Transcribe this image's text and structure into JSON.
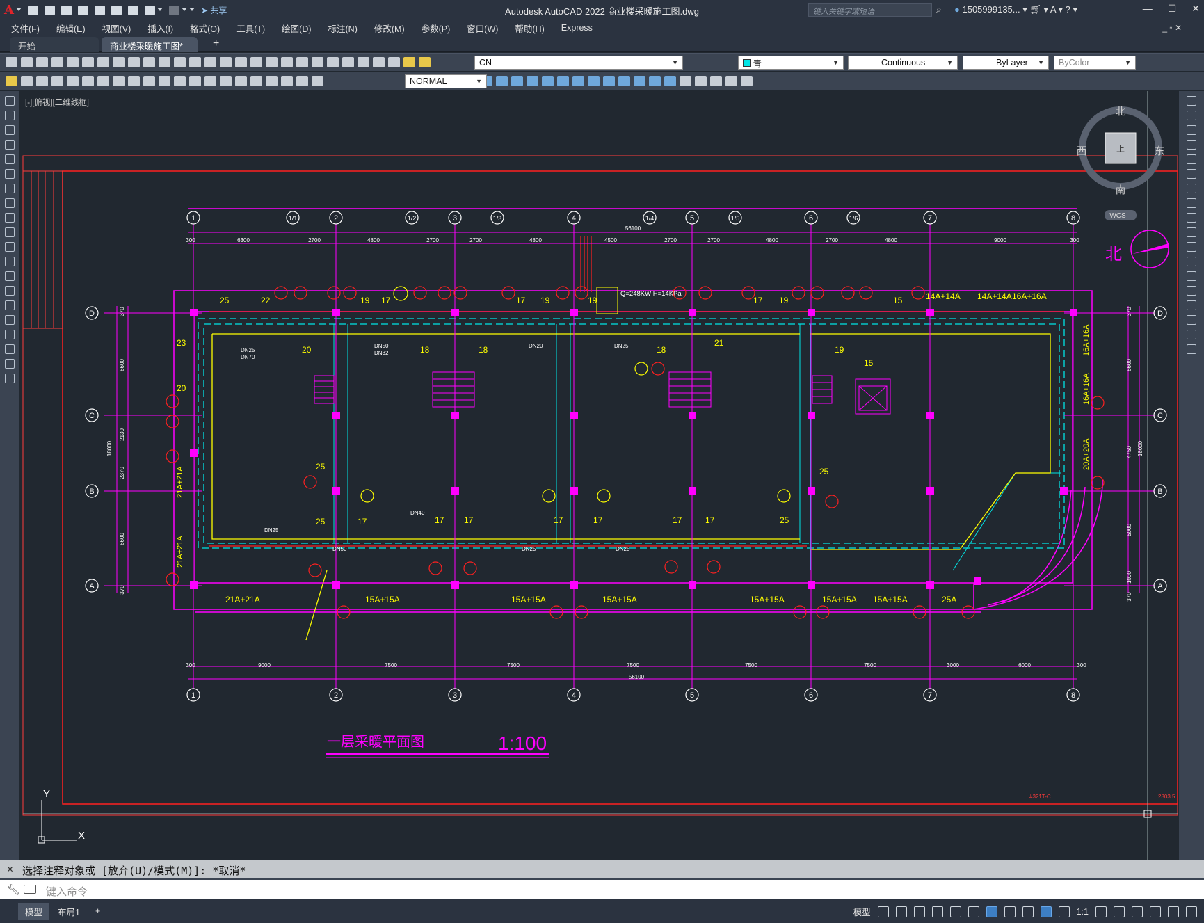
{
  "app": {
    "title": "Autodesk AutoCAD 2022    商业楼采暖施工图.dwg",
    "search_placeholder": "键入关键字或短语",
    "user": "1505999135...",
    "share": "共享"
  },
  "menu": [
    "文件(F)",
    "编辑(E)",
    "视图(V)",
    "插入(I)",
    "格式(O)",
    "工具(T)",
    "绘图(D)",
    "标注(N)",
    "修改(M)",
    "参数(P)",
    "窗口(W)",
    "帮助(H)",
    "Express"
  ],
  "file_tabs": {
    "start": "开始",
    "drawing": "商业楼采暖施工图*",
    "close": "×",
    "new": "+"
  },
  "properties": {
    "layer": "CN",
    "color": "青",
    "linetype": "Continuous",
    "lineweight": "ByLayer",
    "plotstyle": "ByColor",
    "dimstyle": "NORMAL",
    "accent_cyan": "#00e5e5",
    "magenta": "#ff00ff",
    "red": "#ff2020",
    "yellow": "#ffff00"
  },
  "viewport": {
    "label": "[-][俯视][二维线框]"
  },
  "viewcube": {
    "north": "北",
    "south": "南",
    "east": "东",
    "west": "西",
    "top_face": "上",
    "wcs": "WCS",
    "north_arrow": "北"
  },
  "drawing": {
    "title": "一层采暖平面图",
    "scale": "1:100",
    "top_axes": [
      "1",
      "1/1",
      "2",
      "1/2",
      "3",
      "1/3",
      "4",
      "1/4",
      "5",
      "1/5",
      "6",
      "1/6",
      "7",
      "8"
    ],
    "bottom_axes": [
      "1",
      "2",
      "3",
      "4",
      "5",
      "6",
      "7",
      "8"
    ],
    "side_axes": [
      "D",
      "C",
      "B",
      "A"
    ],
    "total_dim": "56100",
    "top_dims": [
      "300",
      "6300",
      "2700",
      "4800",
      "2700",
      "2700",
      "4800",
      "4500",
      "2700",
      "2700",
      "4800",
      "2700",
      "4800",
      "9000",
      "300"
    ],
    "bottom_dims": [
      "300",
      "9000",
      "7500",
      "7500",
      "7500",
      "7500",
      "7500",
      "3000",
      "6000",
      "300"
    ],
    "left_dims": [
      "370",
      "6600",
      "2130",
      "2370",
      "6600",
      "370"
    ],
    "left_total": "18000",
    "right_dims": [
      "370",
      "6600",
      "4750",
      "5000",
      "1000",
      "370"
    ],
    "right_total": "18000",
    "heat_load": "Q=248KW H=14KPa",
    "radiator_numbers": [
      "25",
      "22",
      "19",
      "17",
      "19",
      "17",
      "19",
      "17",
      "19",
      "15",
      "14A+14A",
      "14A+14A",
      "16A+16A",
      "23",
      "20",
      "20",
      "18",
      "18",
      "18",
      "21",
      "19",
      "15",
      "25",
      "25",
      "17",
      "17",
      "17",
      "17",
      "17",
      "17",
      "17",
      "25",
      "25"
    ],
    "radiator_labels_bottom": [
      "21A+21A",
      "15A+15A",
      "15A+15A",
      "15A+15A",
      "15A+15A",
      "15A+15A",
      "15A+15A",
      "25A"
    ],
    "radiator_labels_side": [
      "21A+21A",
      "21A+21A",
      "16A+16A",
      "16A+16A",
      "20A+20A"
    ],
    "pipe_sizes": [
      "DN25",
      "DN70",
      "DN50",
      "DN32",
      "DN40",
      "DN20",
      "DN25",
      "DN25",
      "DN25",
      "DN25",
      "DN50"
    ],
    "margin_notes": [
      "#321T-C",
      "2803.5"
    ]
  },
  "ucs": {
    "y": "Y",
    "x": "X"
  },
  "command": {
    "history": "选择注释对象或 [放弃(U)/模式(M)]: *取消*",
    "placeholder": "键入命令"
  },
  "layouts": {
    "model": "模型",
    "layout1": "布局1",
    "add": "+"
  },
  "status": {
    "model_label": "模型",
    "scale": "1:1"
  }
}
